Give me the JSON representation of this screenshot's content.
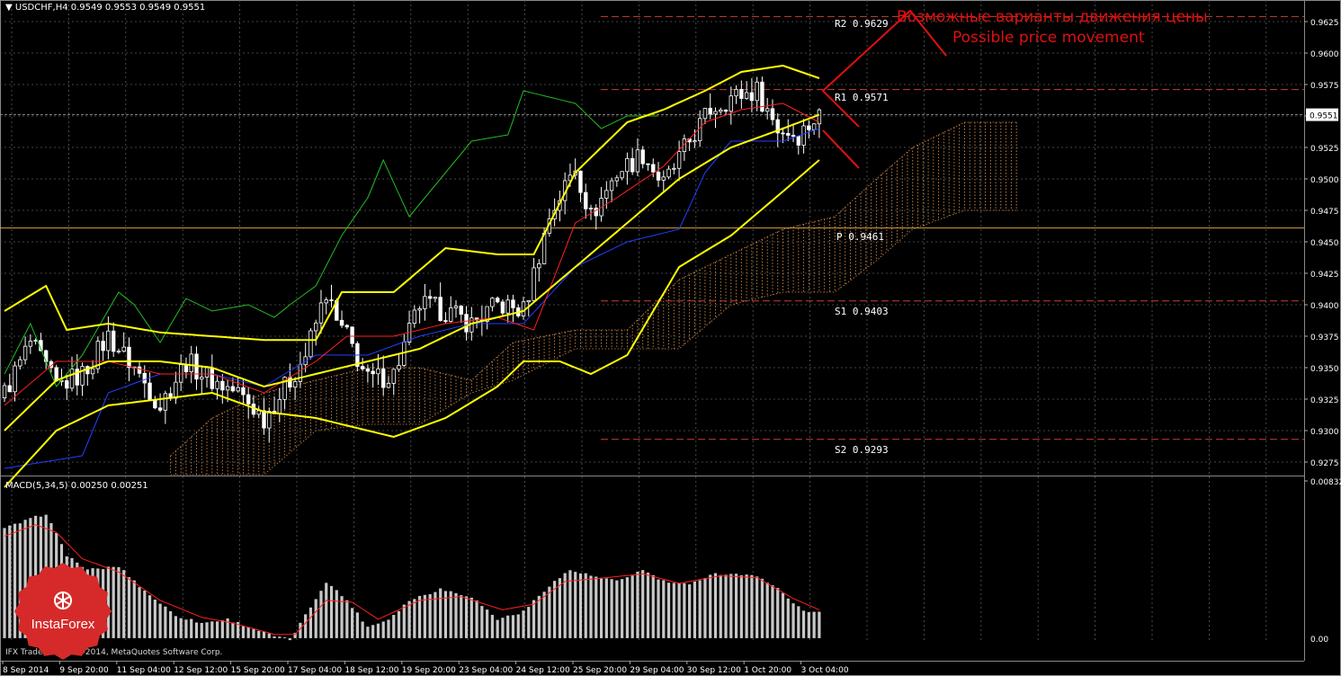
{
  "header": {
    "symbol": "USDCHF,H4",
    "ohlc": "0.9549 0.9553 0.9549 0.9551",
    "macd_label": "MACD(5,34,5)",
    "macd_values": "0.00250 0.00251"
  },
  "annotation": {
    "russian": "Возможные варианты движения цены",
    "english": "Possible price movement",
    "color": "#e01010"
  },
  "copyright": "IFX Trader, © 2001-2014, MetaQuotes Software Corp.",
  "logo": {
    "text": "InstaForex",
    "color": "#d62a2a"
  },
  "levels": [
    {
      "name": "R2",
      "value": "0.9629",
      "label": "R2  0.9629"
    },
    {
      "name": "R1",
      "value": "0.9571",
      "label": "R1  0.9571"
    },
    {
      "name": "P",
      "value": "0.9461",
      "label": "P  0.9461"
    },
    {
      "name": "S1",
      "value": "0.9403",
      "label": "S1  0.9403"
    },
    {
      "name": "S2",
      "value": "0.9293",
      "label": "S2  0.9293"
    }
  ],
  "colors": {
    "background": "#000000",
    "candles": "#ffffff",
    "bollinger": "#ffff00",
    "tenkan": "#ff2020",
    "kijun": "#2040ff",
    "chikou": "#22bb22",
    "kumo": "#d48a4a",
    "macd_hist": "#c8c8c8",
    "macd_signal": "#ff2020",
    "levels": "#c84030",
    "pivot": "#d4a040",
    "current_price": "#a0a0a0"
  },
  "chart_data": {
    "type": "candlestick",
    "symbol": "USDCHF",
    "timeframe": "H4",
    "ylim": [
      0.9265,
      0.964
    ],
    "y_ticks": [
      "0.9625",
      "0.9600",
      "0.9575",
      "0.9550",
      "0.9525",
      "0.9500",
      "0.9475",
      "0.9450",
      "0.9425",
      "0.9400",
      "0.9375",
      "0.9350",
      "0.9325",
      "0.9300",
      "0.9275"
    ],
    "x_ticks": [
      "8 Sep 2014",
      "9 Sep 20:00",
      "11 Sep 04:00",
      "12 Sep 12:00",
      "15 Sep 20:00",
      "17 Sep 04:00",
      "18 Sep 12:00",
      "19 Sep 20:00",
      "23 Sep 04:00",
      "24 Sep 12:00",
      "25 Sep 20:00",
      "29 Sep 04:00",
      "30 Sep 12:00",
      "1 Oct 20:00",
      "3 Oct 04:00"
    ],
    "current_price": "0.9551",
    "close_anchors": [
      {
        "i": 0,
        "v": 0.933
      },
      {
        "i": 5,
        "v": 0.937
      },
      {
        "i": 10,
        "v": 0.9335
      },
      {
        "i": 15,
        "v": 0.9345
      },
      {
        "i": 20,
        "v": 0.9375
      },
      {
        "i": 25,
        "v": 0.935
      },
      {
        "i": 30,
        "v": 0.932
      },
      {
        "i": 35,
        "v": 0.9355
      },
      {
        "i": 40,
        "v": 0.934
      },
      {
        "i": 45,
        "v": 0.933
      },
      {
        "i": 50,
        "v": 0.931
      },
      {
        "i": 55,
        "v": 0.934
      },
      {
        "i": 58,
        "v": 0.936
      },
      {
        "i": 62,
        "v": 0.941
      },
      {
        "i": 64,
        "v": 0.9385
      },
      {
        "i": 66,
        "v": 0.9375
      },
      {
        "i": 70,
        "v": 0.934
      },
      {
        "i": 75,
        "v": 0.9345
      },
      {
        "i": 80,
        "v": 0.94
      },
      {
        "i": 85,
        "v": 0.9395
      },
      {
        "i": 90,
        "v": 0.9385
      },
      {
        "i": 95,
        "v": 0.94
      },
      {
        "i": 100,
        "v": 0.9395
      },
      {
        "i": 105,
        "v": 0.947
      },
      {
        "i": 110,
        "v": 0.951
      },
      {
        "i": 113,
        "v": 0.947
      },
      {
        "i": 118,
        "v": 0.9505
      },
      {
        "i": 123,
        "v": 0.952
      },
      {
        "i": 127,
        "v": 0.9495
      },
      {
        "i": 132,
        "v": 0.953
      },
      {
        "i": 136,
        "v": 0.9555
      },
      {
        "i": 140,
        "v": 0.9565
      },
      {
        "i": 145,
        "v": 0.957
      },
      {
        "i": 149,
        "v": 0.954
      },
      {
        "i": 153,
        "v": 0.9535
      },
      {
        "i": 157,
        "v": 0.9551
      }
    ],
    "bollinger_upper": [
      {
        "i": 0,
        "v": 0.9395
      },
      {
        "i": 8,
        "v": 0.9415
      },
      {
        "i": 12,
        "v": 0.938
      },
      {
        "i": 20,
        "v": 0.9385
      },
      {
        "i": 30,
        "v": 0.9378
      },
      {
        "i": 40,
        "v": 0.9375
      },
      {
        "i": 50,
        "v": 0.9372
      },
      {
        "i": 60,
        "v": 0.9372
      },
      {
        "i": 65,
        "v": 0.941
      },
      {
        "i": 75,
        "v": 0.941
      },
      {
        "i": 85,
        "v": 0.9445
      },
      {
        "i": 95,
        "v": 0.944
      },
      {
        "i": 102,
        "v": 0.944
      },
      {
        "i": 110,
        "v": 0.9505
      },
      {
        "i": 120,
        "v": 0.9545
      },
      {
        "i": 127,
        "v": 0.9555
      },
      {
        "i": 135,
        "v": 0.957
      },
      {
        "i": 142,
        "v": 0.9585
      },
      {
        "i": 150,
        "v": 0.959
      },
      {
        "i": 157,
        "v": 0.958
      }
    ],
    "bollinger_middle": [
      {
        "i": 0,
        "v": 0.93
      },
      {
        "i": 10,
        "v": 0.934
      },
      {
        "i": 20,
        "v": 0.9355
      },
      {
        "i": 30,
        "v": 0.9355
      },
      {
        "i": 40,
        "v": 0.935
      },
      {
        "i": 50,
        "v": 0.9335
      },
      {
        "i": 60,
        "v": 0.9345
      },
      {
        "i": 70,
        "v": 0.9355
      },
      {
        "i": 80,
        "v": 0.9365
      },
      {
        "i": 90,
        "v": 0.9385
      },
      {
        "i": 100,
        "v": 0.9395
      },
      {
        "i": 110,
        "v": 0.943
      },
      {
        "i": 120,
        "v": 0.9465
      },
      {
        "i": 130,
        "v": 0.95
      },
      {
        "i": 140,
        "v": 0.9525
      },
      {
        "i": 150,
        "v": 0.954
      },
      {
        "i": 157,
        "v": 0.9551
      }
    ],
    "bollinger_lower": [
      {
        "i": 0,
        "v": 0.9255
      },
      {
        "i": 10,
        "v": 0.93
      },
      {
        "i": 20,
        "v": 0.932
      },
      {
        "i": 30,
        "v": 0.9325
      },
      {
        "i": 40,
        "v": 0.933
      },
      {
        "i": 50,
        "v": 0.9315
      },
      {
        "i": 60,
        "v": 0.931
      },
      {
        "i": 65,
        "v": 0.9305
      },
      {
        "i": 75,
        "v": 0.9295
      },
      {
        "i": 85,
        "v": 0.931
      },
      {
        "i": 95,
        "v": 0.9335
      },
      {
        "i": 100,
        "v": 0.9355
      },
      {
        "i": 107,
        "v": 0.9355
      },
      {
        "i": 113,
        "v": 0.9345
      },
      {
        "i": 120,
        "v": 0.936
      },
      {
        "i": 130,
        "v": 0.943
      },
      {
        "i": 140,
        "v": 0.9455
      },
      {
        "i": 150,
        "v": 0.949
      },
      {
        "i": 157,
        "v": 0.9515
      }
    ],
    "tenkan": [
      {
        "i": 0,
        "v": 0.932
      },
      {
        "i": 10,
        "v": 0.9355
      },
      {
        "i": 20,
        "v": 0.9355
      },
      {
        "i": 30,
        "v": 0.9345
      },
      {
        "i": 40,
        "v": 0.9345
      },
      {
        "i": 50,
        "v": 0.933
      },
      {
        "i": 60,
        "v": 0.9355
      },
      {
        "i": 66,
        "v": 0.9375
      },
      {
        "i": 75,
        "v": 0.9375
      },
      {
        "i": 85,
        "v": 0.9385
      },
      {
        "i": 95,
        "v": 0.939
      },
      {
        "i": 102,
        "v": 0.938
      },
      {
        "i": 110,
        "v": 0.9465
      },
      {
        "i": 118,
        "v": 0.9485
      },
      {
        "i": 127,
        "v": 0.951
      },
      {
        "i": 135,
        "v": 0.9545
      },
      {
        "i": 142,
        "v": 0.9555
      },
      {
        "i": 150,
        "v": 0.956
      },
      {
        "i": 157,
        "v": 0.9545
      }
    ],
    "kijun": [
      {
        "i": 0,
        "v": 0.927
      },
      {
        "i": 15,
        "v": 0.928
      },
      {
        "i": 20,
        "v": 0.933
      },
      {
        "i": 30,
        "v": 0.9345
      },
      {
        "i": 40,
        "v": 0.9345
      },
      {
        "i": 50,
        "v": 0.9335
      },
      {
        "i": 60,
        "v": 0.936
      },
      {
        "i": 70,
        "v": 0.936
      },
      {
        "i": 80,
        "v": 0.9375
      },
      {
        "i": 90,
        "v": 0.9385
      },
      {
        "i": 100,
        "v": 0.9385
      },
      {
        "i": 110,
        "v": 0.943
      },
      {
        "i": 120,
        "v": 0.945
      },
      {
        "i": 130,
        "v": 0.946
      },
      {
        "i": 135,
        "v": 0.9505
      },
      {
        "i": 140,
        "v": 0.953
      },
      {
        "i": 150,
        "v": 0.953
      },
      {
        "i": 157,
        "v": 0.954
      }
    ],
    "chikou": [
      {
        "i": 0,
        "v": 0.9345
      },
      {
        "i": 5,
        "v": 0.9385
      },
      {
        "i": 10,
        "v": 0.9335
      },
      {
        "i": 15,
        "v": 0.936
      },
      {
        "i": 22,
        "v": 0.941
      },
      {
        "i": 25,
        "v": 0.94
      },
      {
        "i": 30,
        "v": 0.937
      },
      {
        "i": 35,
        "v": 0.9405
      },
      {
        "i": 40,
        "v": 0.9395
      },
      {
        "i": 47,
        "v": 0.94
      },
      {
        "i": 52,
        "v": 0.939
      },
      {
        "i": 55,
        "v": 0.94
      },
      {
        "i": 60,
        "v": 0.9415
      },
      {
        "i": 65,
        "v": 0.9455
      },
      {
        "i": 70,
        "v": 0.9485
      },
      {
        "i": 73,
        "v": 0.9515
      },
      {
        "i": 78,
        "v": 0.947
      },
      {
        "i": 85,
        "v": 0.9505
      },
      {
        "i": 90,
        "v": 0.953
      },
      {
        "i": 97,
        "v": 0.9535
      },
      {
        "i": 100,
        "v": 0.957
      },
      {
        "i": 105,
        "v": 0.9565
      },
      {
        "i": 110,
        "v": 0.956
      },
      {
        "i": 115,
        "v": 0.954
      },
      {
        "i": 120,
        "v": 0.955
      },
      {
        "i": 126,
        "v": 0.955
      }
    ],
    "kumo_a": [
      {
        "i": 32,
        "v": 0.928
      },
      {
        "i": 40,
        "v": 0.931
      },
      {
        "i": 50,
        "v": 0.933
      },
      {
        "i": 60,
        "v": 0.934
      },
      {
        "i": 70,
        "v": 0.935
      },
      {
        "i": 80,
        "v": 0.935
      },
      {
        "i": 90,
        "v": 0.934
      },
      {
        "i": 98,
        "v": 0.937
      },
      {
        "i": 110,
        "v": 0.938
      },
      {
        "i": 120,
        "v": 0.938
      },
      {
        "i": 130,
        "v": 0.942
      },
      {
        "i": 140,
        "v": 0.944
      },
      {
        "i": 150,
        "v": 0.946
      },
      {
        "i": 160,
        "v": 0.947
      },
      {
        "i": 168,
        "v": 0.95
      },
      {
        "i": 175,
        "v": 0.9525
      },
      {
        "i": 185,
        "v": 0.9545
      },
      {
        "i": 195,
        "v": 0.9545
      }
    ],
    "kumo_b": [
      {
        "i": 32,
        "v": 0.9265
      },
      {
        "i": 40,
        "v": 0.9265
      },
      {
        "i": 50,
        "v": 0.9265
      },
      {
        "i": 60,
        "v": 0.93
      },
      {
        "i": 70,
        "v": 0.9305
      },
      {
        "i": 80,
        "v": 0.9305
      },
      {
        "i": 90,
        "v": 0.933
      },
      {
        "i": 98,
        "v": 0.934
      },
      {
        "i": 110,
        "v": 0.9365
      },
      {
        "i": 120,
        "v": 0.9365
      },
      {
        "i": 130,
        "v": 0.9365
      },
      {
        "i": 140,
        "v": 0.94
      },
      {
        "i": 150,
        "v": 0.941
      },
      {
        "i": 160,
        "v": 0.941
      },
      {
        "i": 168,
        "v": 0.9435
      },
      {
        "i": 175,
        "v": 0.946
      },
      {
        "i": 185,
        "v": 0.9475
      },
      {
        "i": 195,
        "v": 0.9475
      }
    ],
    "macd": {
      "label": "MACD(5,34,5)",
      "ylim": [
        -0.0001,
        0.00832
      ],
      "y_ticks": [
        "0.00832",
        "0.00"
      ],
      "hist_anchors": [
        {
          "i": 0,
          "v": 0.0058
        },
        {
          "i": 4,
          "v": 0.0062
        },
        {
          "i": 8,
          "v": 0.0066
        },
        {
          "i": 12,
          "v": 0.0044
        },
        {
          "i": 16,
          "v": 0.0036
        },
        {
          "i": 22,
          "v": 0.0038
        },
        {
          "i": 27,
          "v": 0.0025
        },
        {
          "i": 33,
          "v": 0.0012
        },
        {
          "i": 38,
          "v": 0.0008
        },
        {
          "i": 43,
          "v": 0.001
        },
        {
          "i": 48,
          "v": 0.0005
        },
        {
          "i": 52,
          "v": 0.0001
        },
        {
          "i": 55,
          "v": -0.0001
        },
        {
          "i": 58,
          "v": 0.0012
        },
        {
          "i": 62,
          "v": 0.003
        },
        {
          "i": 66,
          "v": 0.002
        },
        {
          "i": 70,
          "v": 0.0006
        },
        {
          "i": 74,
          "v": 0.001
        },
        {
          "i": 78,
          "v": 0.002
        },
        {
          "i": 84,
          "v": 0.0026
        },
        {
          "i": 90,
          "v": 0.0022
        },
        {
          "i": 95,
          "v": 0.001
        },
        {
          "i": 100,
          "v": 0.0014
        },
        {
          "i": 105,
          "v": 0.0028
        },
        {
          "i": 109,
          "v": 0.0036
        },
        {
          "i": 113,
          "v": 0.0033
        },
        {
          "i": 118,
          "v": 0.003
        },
        {
          "i": 123,
          "v": 0.0036
        },
        {
          "i": 127,
          "v": 0.003
        },
        {
          "i": 132,
          "v": 0.0028
        },
        {
          "i": 136,
          "v": 0.0034
        },
        {
          "i": 141,
          "v": 0.0034
        },
        {
          "i": 146,
          "v": 0.0032
        },
        {
          "i": 150,
          "v": 0.0024
        },
        {
          "i": 154,
          "v": 0.0014
        },
        {
          "i": 157,
          "v": 0.0014
        }
      ],
      "signal_anchors": [
        {
          "i": 0,
          "v": 0.0054
        },
        {
          "i": 6,
          "v": 0.006
        },
        {
          "i": 10,
          "v": 0.0056
        },
        {
          "i": 15,
          "v": 0.0042
        },
        {
          "i": 22,
          "v": 0.0035
        },
        {
          "i": 30,
          "v": 0.002
        },
        {
          "i": 38,
          "v": 0.0011
        },
        {
          "i": 44,
          "v": 0.0008
        },
        {
          "i": 52,
          "v": 0.0002
        },
        {
          "i": 56,
          "v": 0.0002
        },
        {
          "i": 62,
          "v": 0.002
        },
        {
          "i": 67,
          "v": 0.0019
        },
        {
          "i": 72,
          "v": 0.001
        },
        {
          "i": 80,
          "v": 0.002
        },
        {
          "i": 88,
          "v": 0.0022
        },
        {
          "i": 96,
          "v": 0.0015
        },
        {
          "i": 102,
          "v": 0.0018
        },
        {
          "i": 108,
          "v": 0.003
        },
        {
          "i": 116,
          "v": 0.0032
        },
        {
          "i": 123,
          "v": 0.0034
        },
        {
          "i": 130,
          "v": 0.0029
        },
        {
          "i": 138,
          "v": 0.0033
        },
        {
          "i": 145,
          "v": 0.0032
        },
        {
          "i": 152,
          "v": 0.0021
        },
        {
          "i": 157,
          "v": 0.0015
        }
      ]
    }
  }
}
